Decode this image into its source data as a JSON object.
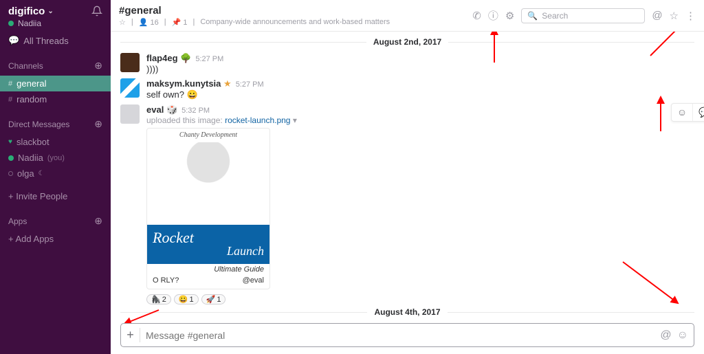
{
  "workspace": {
    "name": "digifico",
    "current_user": "Nadiia"
  },
  "sidebar": {
    "all_threads": "All Threads",
    "channels_label": "Channels",
    "channels": [
      {
        "name": "general",
        "active": true
      },
      {
        "name": "random",
        "active": false
      }
    ],
    "dm_label": "Direct Messages",
    "dms": [
      {
        "name": "slackbot",
        "you": false,
        "presence": "heart"
      },
      {
        "name": "Nadiia",
        "you": true,
        "presence": "active"
      },
      {
        "name": "olga",
        "you": false,
        "presence": "away"
      }
    ],
    "invite": "Invite People",
    "apps_label": "Apps",
    "add_apps": "Add Apps"
  },
  "channel": {
    "name": "#general",
    "members": "16",
    "pins": "1",
    "topic": "Company-wide announcements and work-based matters",
    "star_glyph": "☆",
    "user_glyph": "👤",
    "pin_glyph": "📌"
  },
  "search": {
    "placeholder": "Search"
  },
  "dividers": {
    "d1": "August 2nd, 2017",
    "d2": "August 4th, 2017"
  },
  "messages": [
    {
      "user": "flap4eg",
      "badge": "🌳",
      "time": "5:27 PM",
      "text": "))))"
    },
    {
      "user": "maksym.kunytsia",
      "badge": "★",
      "time": "5:27 PM",
      "text": "self own? 😀"
    },
    {
      "user": "eval",
      "badge": "🎲",
      "time": "5:32 PM",
      "caption_prefix": "uploaded this image: ",
      "filename": "rocket-launch.png",
      "attachment": {
        "top_label": "Chanty Development",
        "line1": "Rocket",
        "line2": "Launch",
        "subtitle": "Ultimate Guide",
        "footer_left": "O RLY?",
        "footer_right": "@eval"
      },
      "reactions": [
        {
          "emoji": "🦍",
          "count": "2"
        },
        {
          "emoji": "😀",
          "count": "1"
        },
        {
          "emoji": "🚀",
          "count": "1"
        }
      ]
    }
  ],
  "composer": {
    "placeholder": "Message #general"
  }
}
